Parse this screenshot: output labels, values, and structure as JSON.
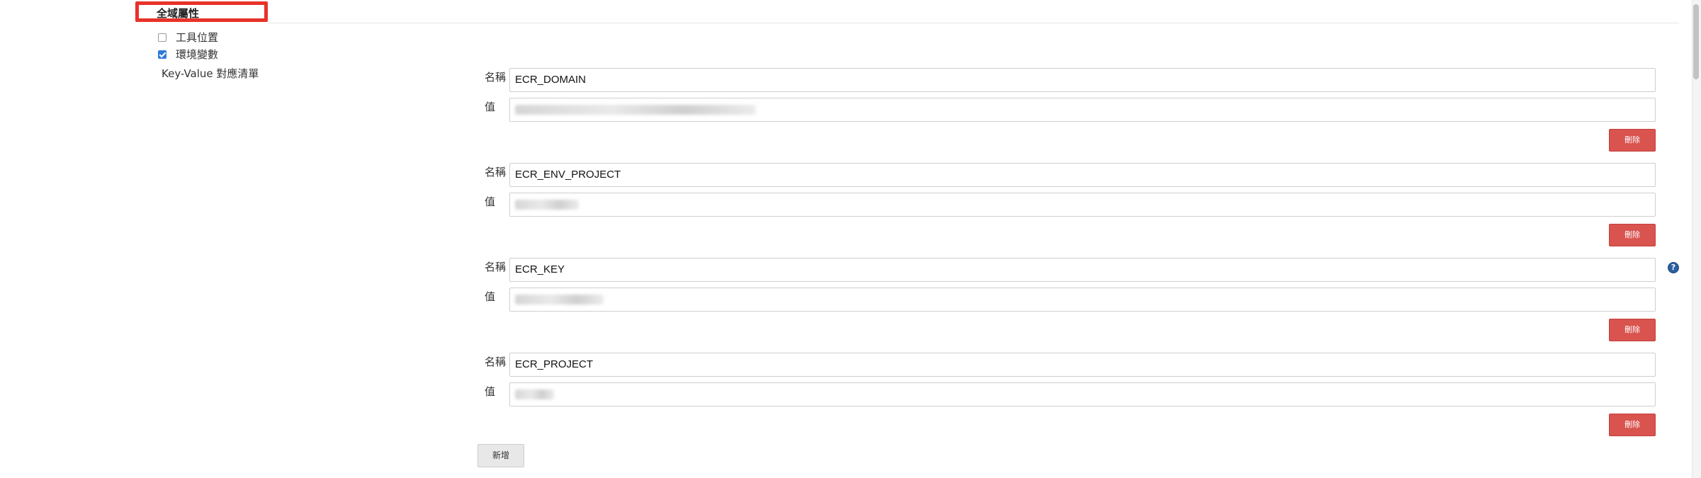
{
  "section": {
    "title": "全域屬性"
  },
  "options": {
    "tool_locations_label": "工具位置",
    "tool_locations_checked": false,
    "env_vars_label": "環境變數",
    "env_vars_checked": true
  },
  "kv_list_label": "Key-Value 對應清單",
  "entries": [
    {
      "name_label": "名稱",
      "name_value": "ECR_DOMAIN",
      "value_label": "值",
      "value_obscured": true,
      "delete_label": "刪除"
    },
    {
      "name_label": "名稱",
      "name_value": "ECR_ENV_PROJECT",
      "value_label": "值",
      "value_obscured": true,
      "delete_label": "刪除"
    },
    {
      "name_label": "名稱",
      "name_value": "ECR_KEY",
      "value_label": "值",
      "value_obscured": true,
      "delete_label": "刪除"
    },
    {
      "name_label": "名稱",
      "name_value": "ECR_PROJECT",
      "value_label": "值",
      "value_obscured": true,
      "delete_label": "刪除"
    }
  ],
  "add_button_label": "新增",
  "help_icon_glyph": "?",
  "colors": {
    "highlight_border": "#e8322a",
    "delete_button": "#d9534f",
    "checkbox_checked": "#2f7bdb",
    "help_icon": "#2c5f9e"
  }
}
